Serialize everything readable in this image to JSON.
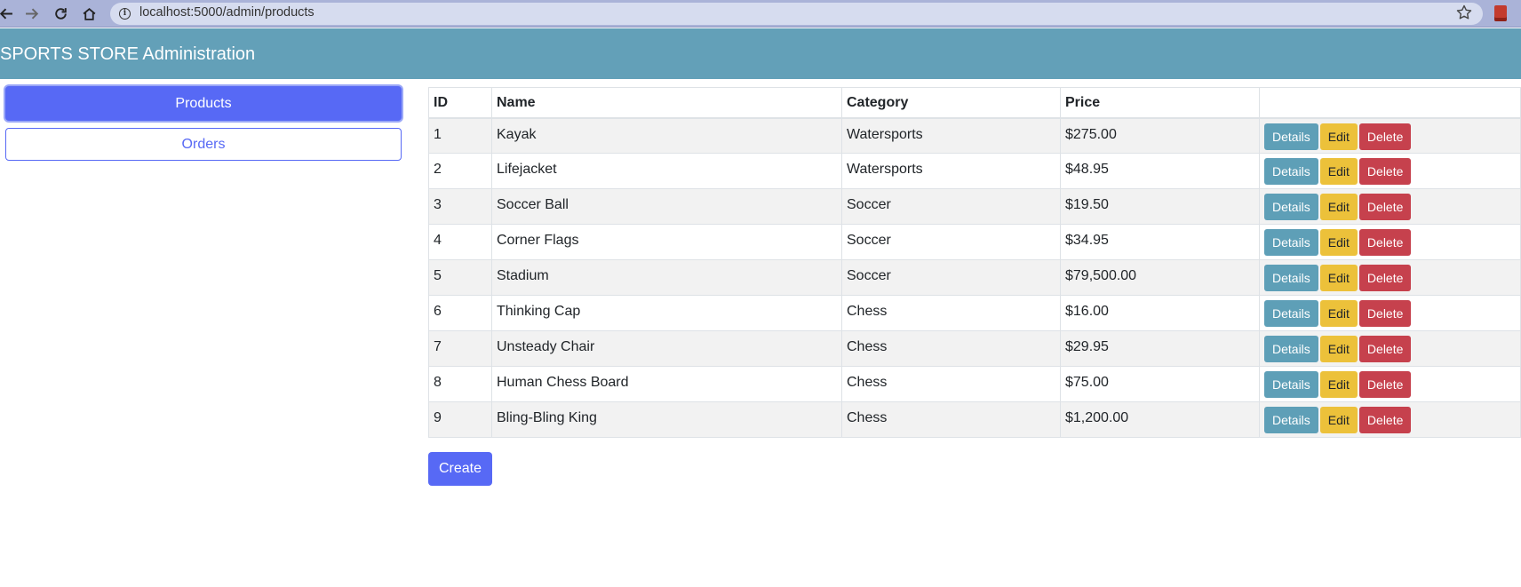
{
  "browser": {
    "url": "localhost:5000/admin/products"
  },
  "header": {
    "title": "SPORTS STORE Administration"
  },
  "sidebar": {
    "items": [
      {
        "label": "Products",
        "active": true
      },
      {
        "label": "Orders",
        "active": false
      }
    ]
  },
  "table": {
    "headers": [
      "ID",
      "Name",
      "Category",
      "Price",
      ""
    ],
    "actions": {
      "details": "Details",
      "edit": "Edit",
      "delete": "Delete"
    },
    "rows": [
      {
        "id": "1",
        "name": "Kayak",
        "category": "Watersports",
        "price": "$275.00"
      },
      {
        "id": "2",
        "name": "Lifejacket",
        "category": "Watersports",
        "price": "$48.95"
      },
      {
        "id": "3",
        "name": "Soccer Ball",
        "category": "Soccer",
        "price": "$19.50"
      },
      {
        "id": "4",
        "name": "Corner Flags",
        "category": "Soccer",
        "price": "$34.95"
      },
      {
        "id": "5",
        "name": "Stadium",
        "category": "Soccer",
        "price": "$79,500.00"
      },
      {
        "id": "6",
        "name": "Thinking Cap",
        "category": "Chess",
        "price": "$16.00"
      },
      {
        "id": "7",
        "name": "Unsteady Chair",
        "category": "Chess",
        "price": "$29.95"
      },
      {
        "id": "8",
        "name": "Human Chess Board",
        "category": "Chess",
        "price": "$75.00"
      },
      {
        "id": "9",
        "name": "Bling-Bling King",
        "category": "Chess",
        "price": "$1,200.00"
      }
    ]
  },
  "create_label": "Create",
  "colors": {
    "header_bg": "#63a0b8",
    "primary": "#5769f5",
    "info": "#5e9fb7",
    "warning": "#ecc13a",
    "danger": "#c6414d"
  },
  "icons": [
    "back-arrow-icon",
    "forward-arrow-icon",
    "reload-icon",
    "home-icon",
    "info-icon",
    "star-icon",
    "extension-icon"
  ]
}
